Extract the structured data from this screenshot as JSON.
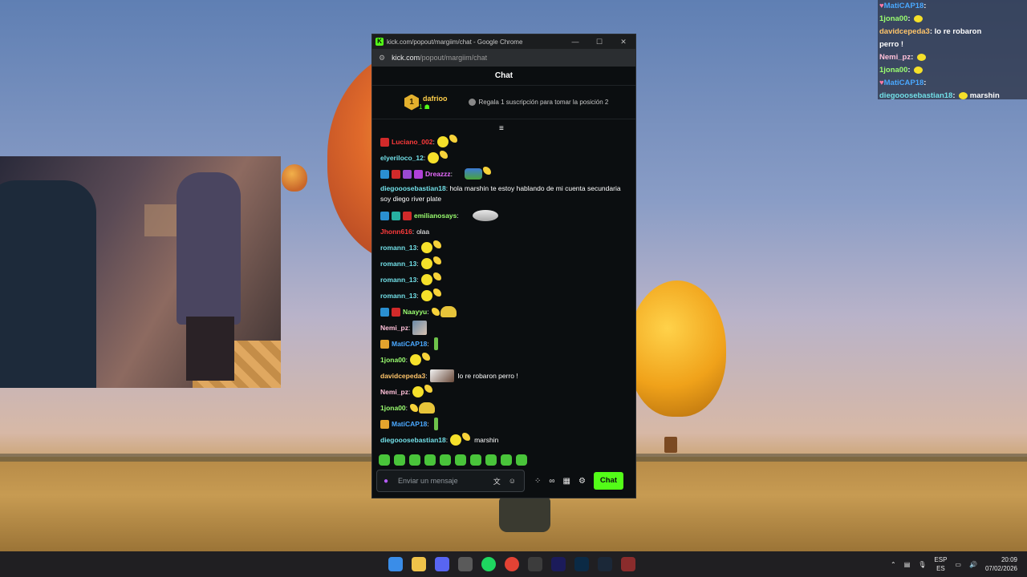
{
  "browser": {
    "window_title": "kick.com/popout/margiim/chat - Google Chrome",
    "url_domain": "kick.com",
    "url_path": "/popout/margiim/chat"
  },
  "chat": {
    "header": "Chat",
    "pinned": {
      "rank": "1",
      "user": "dafrioo",
      "count": "1",
      "gift_text": "Regala 1 suscripción para tomar la posición 2"
    },
    "messages": [
      {
        "user": "Luciano_002",
        "color": "#ff3b3b",
        "text": ""
      },
      {
        "user": "elyeriloco_12",
        "color": "#72e0e8",
        "text": ""
      },
      {
        "user": "Dreazzz",
        "color": "#e86bff",
        "text": ""
      },
      {
        "user": "diegooosebastian18",
        "color": "#72e0e8",
        "text": "hola marshin te estoy hablando de mi cuenta secundaria soy diego river plate"
      },
      {
        "user": "emilianosays",
        "color": "#9bff70",
        "text": ""
      },
      {
        "user": "Jhonn616",
        "color": "#ff3b3b",
        "text": "olaa"
      },
      {
        "user": "romann_13",
        "color": "#72e0e8",
        "text": ""
      },
      {
        "user": "romann_13",
        "color": "#72e0e8",
        "text": ""
      },
      {
        "user": "romann_13",
        "color": "#72e0e8",
        "text": ""
      },
      {
        "user": "romann_13",
        "color": "#72e0e8",
        "text": ""
      },
      {
        "user": "Naayyu",
        "color": "#9bff70",
        "text": ""
      },
      {
        "user": "Nemi_pz",
        "color": "#ffc0d8",
        "text": ""
      },
      {
        "user": "MatiCAP18",
        "color": "#4aa8ff",
        "text": ""
      },
      {
        "user": "1jona00",
        "color": "#9bff70",
        "text": ""
      },
      {
        "user": "davidcepeda3",
        "color": "#ffc56a",
        "text": "lo re robaron perro !"
      },
      {
        "user": "Nemi_pz",
        "color": "#ffc0d8",
        "text": ""
      },
      {
        "user": "1jona00",
        "color": "#9bff70",
        "text": ""
      },
      {
        "user": "MatiCAP18",
        "color": "#4aa8ff",
        "text": ""
      },
      {
        "user": "diegooosebastian18",
        "color": "#72e0e8",
        "text": "marshin"
      }
    ],
    "input_placeholder": "Enviar un mensaje",
    "send_label": "Chat"
  },
  "overlay": {
    "lines": [
      {
        "user": "MatiCAP18",
        "color": "#4aa8ff",
        "text": ""
      },
      {
        "user": "1jona00",
        "color": "#9bff70",
        "text": ""
      },
      {
        "user": "davidcepeda3",
        "color": "#ffc56a",
        "text": "lo re robaron"
      },
      {
        "user": "",
        "color": "#ffffff",
        "text": "perro !"
      },
      {
        "user": "Nemi_pz",
        "color": "#ffc0d8",
        "text": ""
      },
      {
        "user": "1jona00",
        "color": "#9bff70",
        "text": ""
      },
      {
        "user": "MatiCAP18",
        "color": "#4aa8ff",
        "text": ""
      },
      {
        "user": "diegooosebastian18",
        "color": "#72e0e8",
        "text": "marshin"
      }
    ]
  },
  "taskbar": {
    "lang_top": "ESP",
    "lang_bottom": "ES",
    "time": "20:09",
    "date": "07/02/2026"
  },
  "colors": {
    "kick_green": "#53fc18",
    "window_bg": "#0b0e10"
  }
}
